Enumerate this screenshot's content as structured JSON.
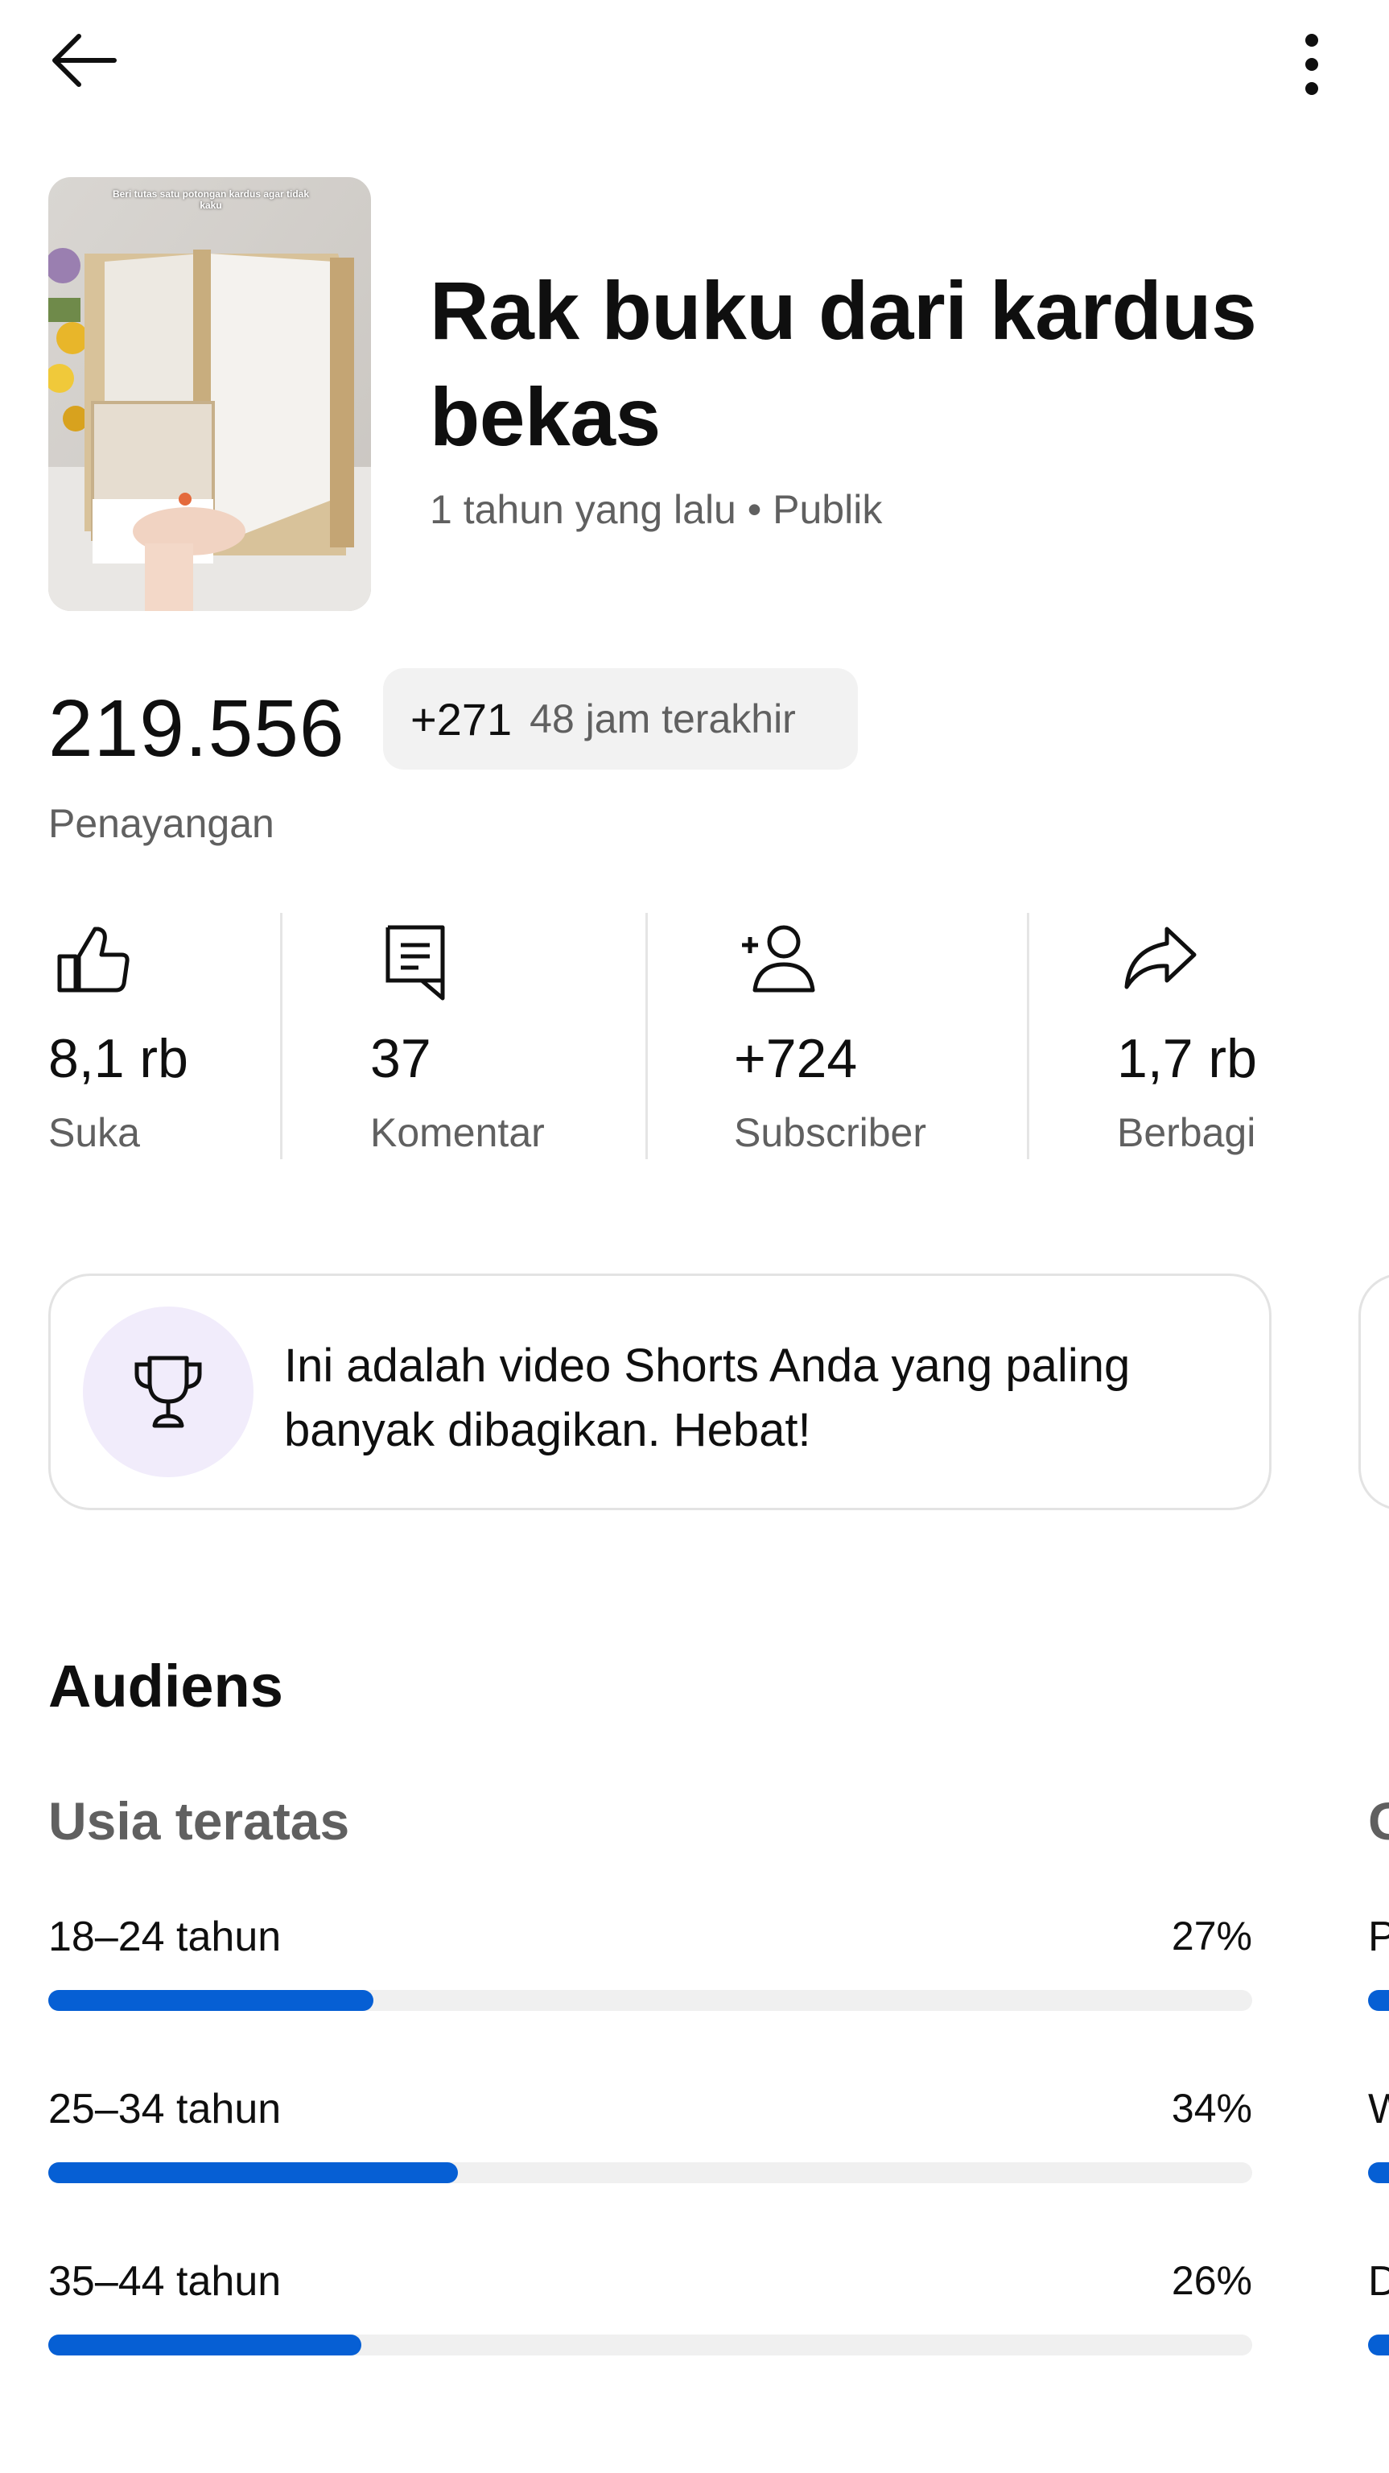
{
  "toolbar": {
    "back_icon": "arrow-left-icon",
    "menu_icon": "more-vert-icon"
  },
  "video": {
    "thumbnail_caption": "Beri tutas satu potongan kardus agar tidak kaku",
    "title": "Rak buku dari kardus bekas",
    "meta": "1 tahun yang lalu • Publik"
  },
  "views": {
    "total": "219.556",
    "recent_change": "+271",
    "recent_label": "48 jam terakhir",
    "label": "Penayangan"
  },
  "stats": [
    {
      "icon": "thumbs-up-icon",
      "value": "8,1 rb",
      "label": "Suka"
    },
    {
      "icon": "comment-icon",
      "value": "37",
      "label": "Komentar"
    },
    {
      "icon": "add-person-icon",
      "value": "+724",
      "label": "Subscriber"
    },
    {
      "icon": "share-icon",
      "value": "1,7 rb",
      "label": "Berbagi"
    }
  ],
  "insight": {
    "icon": "trophy-icon",
    "text": "Ini adalah video Shorts Anda yang paling banyak dibagikan. Hebat!"
  },
  "audience": {
    "title": "Audiens",
    "age_heading": "Usia teratas",
    "next_card_heading": "G",
    "age_groups": [
      {
        "label": "18–24 tahun",
        "value": "27%",
        "percent": 27
      },
      {
        "label": "25–34 tahun",
        "value": "34%",
        "percent": 34
      },
      {
        "label": "35–44 tahun",
        "value": "26%",
        "percent": 26
      }
    ],
    "next_card_rows": [
      "P",
      "W",
      "D"
    ]
  },
  "colors": {
    "accent": "#065fd4",
    "secondary_text": "#606060",
    "chip_bg": "#f2f2f2",
    "insight_circle": "#f1ecfb"
  }
}
